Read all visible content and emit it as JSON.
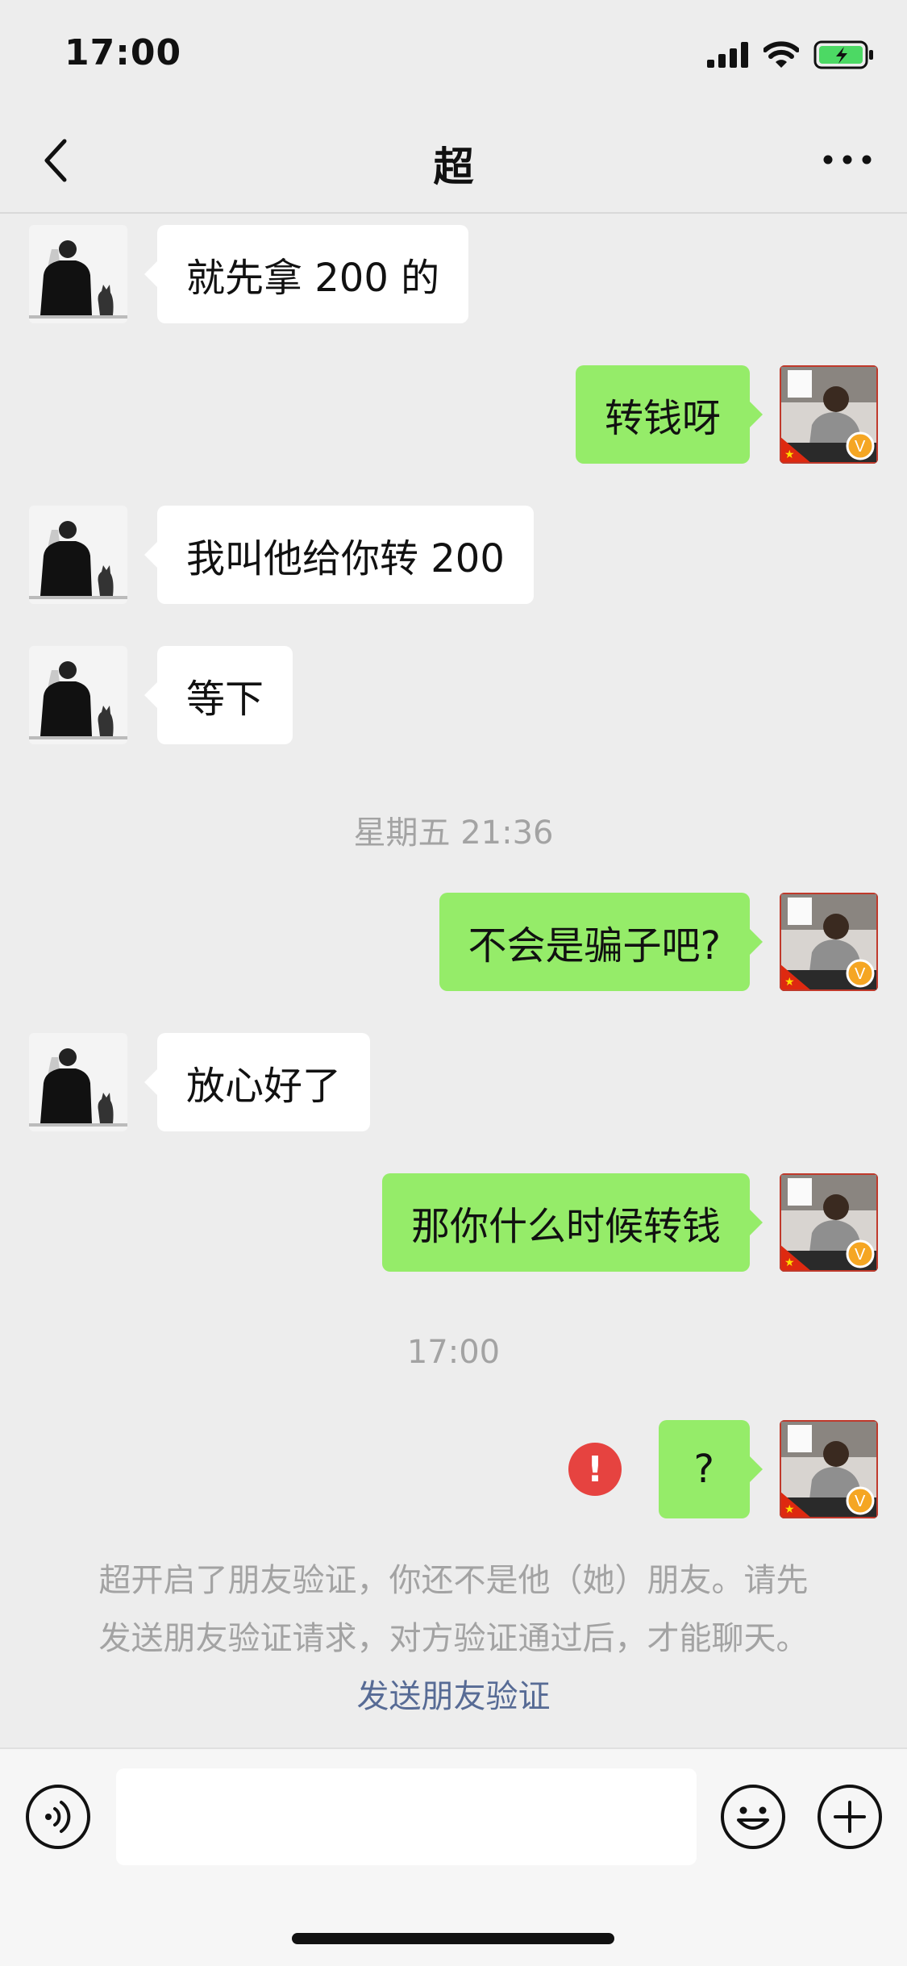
{
  "status_bar": {
    "time": "17:00"
  },
  "header": {
    "title": "超"
  },
  "messages": [
    {
      "side": "in",
      "text": "就先拿 200 的"
    },
    {
      "side": "out",
      "text": "转钱呀"
    },
    {
      "side": "in",
      "text": "我叫他给你转 200"
    },
    {
      "side": "in",
      "text": "等下"
    },
    {
      "side": "out",
      "text": "不会是骗子吧?"
    },
    {
      "side": "in",
      "text": "放心好了"
    },
    {
      "side": "out",
      "text": "那你什么时候转钱"
    },
    {
      "side": "out",
      "text": "?",
      "failed": true,
      "error_symbol": "!"
    }
  ],
  "timestamps": [
    "星期五 21:36",
    "17:00"
  ],
  "notice": {
    "line1": "超开启了朋友验证，你还不是他（她）朋友。请先",
    "line2": "发送朋友验证请求，对方验证通过后，才能聊天。",
    "link": "发送朋友验证"
  },
  "colors": {
    "bubble_out": "#95ec69",
    "bubble_in": "#ffffff",
    "error": "#e64340",
    "link": "#576b95",
    "background": "#ededed"
  },
  "icons": {
    "back": "chevron-left-icon",
    "more": "more-dots-icon",
    "voice": "voice-icon",
    "emoji": "emoji-icon",
    "plus": "plus-icon",
    "failed": "error-icon"
  }
}
